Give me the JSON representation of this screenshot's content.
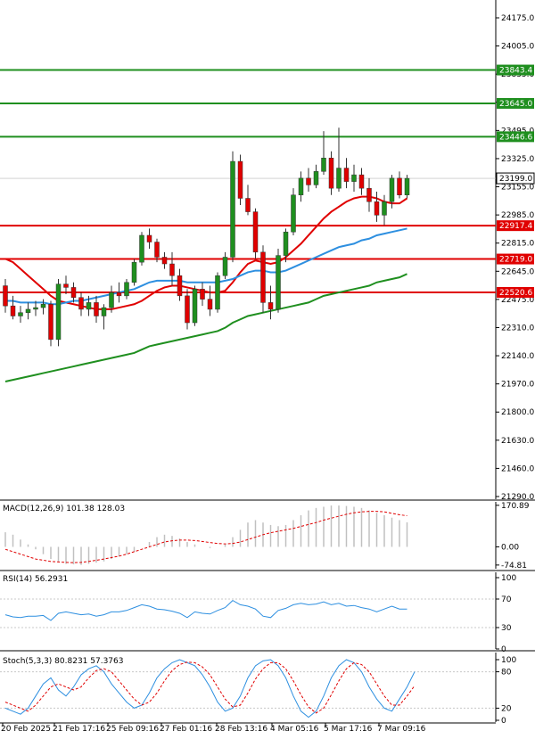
{
  "chart_data": [
    {
      "type": "candlestick",
      "panel": "price",
      "y_ticks": [
        "24175.0",
        "24005.0",
        "23835.0",
        "23665.0",
        "23495.0",
        "23325.0",
        "23155.0",
        "22985.0",
        "22815.0",
        "22645.0",
        "22475.0",
        "22310.0",
        "22140.0",
        "21970.0",
        "21800.0",
        "21630.0",
        "21460.0",
        "21290.0"
      ],
      "ylim": [
        21290,
        24260
      ],
      "levels": [
        {
          "label": "23843.4",
          "value": 23843.4,
          "color": "#1f8f1f"
        },
        {
          "label": "23645.0",
          "value": 23645.0,
          "color": "#1f8f1f"
        },
        {
          "label": "23446.6",
          "value": 23446.6,
          "color": "#1f8f1f"
        },
        {
          "label": "22917.4",
          "value": 22917.4,
          "color": "#e00000"
        },
        {
          "label": "22719.0",
          "value": 22719.0,
          "color": "#e00000"
        },
        {
          "label": "22520.6",
          "value": 22520.6,
          "color": "#e00000"
        }
      ],
      "current_price": {
        "label": "23199.0",
        "value": 23199.0
      },
      "x_ticks": [
        "20 Feb 2025",
        "21 Feb 17:16",
        "25 Feb 09:16",
        "27 Feb 01:16",
        "28 Feb 13:16",
        "4 Mar 05:16",
        "5 Mar 17:16",
        "7 Mar 09:16"
      ],
      "candles": [
        [
          22560,
          22600,
          22400,
          22440
        ],
        [
          22440,
          22500,
          22360,
          22380
        ],
        [
          22380,
          22440,
          22340,
          22400
        ],
        [
          22400,
          22460,
          22360,
          22420
        ],
        [
          22420,
          22470,
          22380,
          22430
        ],
        [
          22430,
          22480,
          22390,
          22450
        ],
        [
          22450,
          22470,
          22200,
          22240
        ],
        [
          22240,
          22600,
          22200,
          22570
        ],
        [
          22570,
          22620,
          22510,
          22550
        ],
        [
          22550,
          22580,
          22460,
          22490
        ],
        [
          22490,
          22520,
          22380,
          22420
        ],
        [
          22420,
          22500,
          22380,
          22460
        ],
        [
          22460,
          22500,
          22340,
          22380
        ],
        [
          22380,
          22450,
          22300,
          22430
        ],
        [
          22430,
          22560,
          22400,
          22520
        ],
        [
          22520,
          22580,
          22460,
          22500
        ],
        [
          22500,
          22600,
          22480,
          22580
        ],
        [
          22580,
          22720,
          22560,
          22700
        ],
        [
          22700,
          22880,
          22680,
          22860
        ],
        [
          22860,
          22900,
          22780,
          22820
        ],
        [
          22820,
          22840,
          22700,
          22730
        ],
        [
          22730,
          22760,
          22660,
          22690
        ],
        [
          22690,
          22760,
          22560,
          22620
        ],
        [
          22620,
          22660,
          22470,
          22500
        ],
        [
          22500,
          22540,
          22300,
          22340
        ],
        [
          22340,
          22560,
          22320,
          22540
        ],
        [
          22540,
          22580,
          22440,
          22480
        ],
        [
          22480,
          22560,
          22380,
          22420
        ],
        [
          22420,
          22640,
          22400,
          22620
        ],
        [
          22620,
          22760,
          22600,
          22730
        ],
        [
          22730,
          23360,
          22700,
          23300
        ],
        [
          23300,
          23340,
          23040,
          23080
        ],
        [
          23080,
          23160,
          22980,
          23000
        ],
        [
          23000,
          23020,
          22720,
          22760
        ],
        [
          22760,
          22800,
          22400,
          22460
        ],
        [
          22460,
          22560,
          22360,
          22420
        ],
        [
          22420,
          22780,
          22400,
          22740
        ],
        [
          22740,
          22900,
          22700,
          22880
        ],
        [
          22880,
          23140,
          22860,
          23100
        ],
        [
          23100,
          23240,
          23060,
          23200
        ],
        [
          23200,
          23260,
          23120,
          23160
        ],
        [
          23160,
          23280,
          23140,
          23240
        ],
        [
          23240,
          23480,
          23220,
          23320
        ],
        [
          23320,
          23360,
          23100,
          23140
        ],
        [
          23140,
          23500,
          23120,
          23260
        ],
        [
          23260,
          23320,
          23140,
          23180
        ],
        [
          23180,
          23280,
          23120,
          23220
        ],
        [
          23220,
          23260,
          23100,
          23140
        ],
        [
          23140,
          23200,
          23000,
          23060
        ],
        [
          23060,
          23120,
          22940,
          22980
        ],
        [
          22980,
          23100,
          22920,
          23060
        ],
        [
          23060,
          23220,
          23020,
          23200
        ],
        [
          23200,
          23240,
          23080,
          23100
        ],
        [
          23100,
          23220,
          23080,
          23199
        ]
      ],
      "ma_series": [
        {
          "color": "#e00000",
          "values": [
            22720,
            22700,
            22660,
            22620,
            22580,
            22540,
            22500,
            22470,
            22460,
            22450,
            22440,
            22430,
            22420,
            22420,
            22420,
            22430,
            22440,
            22450,
            22470,
            22500,
            22530,
            22550,
            22560,
            22560,
            22550,
            22540,
            22530,
            22520,
            22520,
            22530,
            22580,
            22640,
            22690,
            22710,
            22700,
            22690,
            22700,
            22730,
            22770,
            22810,
            22860,
            22910,
            22960,
            23000,
            23030,
            23060,
            23080,
            23090,
            23090,
            23080,
            23060,
            23050,
            23050,
            23080
          ]
        },
        {
          "color": "#2d8fe0",
          "values": [
            22470,
            22470,
            22460,
            22460,
            22460,
            22460,
            22450,
            22450,
            22460,
            22470,
            22470,
            22480,
            22490,
            22500,
            22510,
            22520,
            22530,
            22540,
            22560,
            22580,
            22590,
            22590,
            22590,
            22590,
            22580,
            22580,
            22580,
            22580,
            22580,
            22590,
            22600,
            22620,
            22640,
            22650,
            22650,
            22640,
            22640,
            22650,
            22670,
            22690,
            22710,
            22730,
            22750,
            22770,
            22790,
            22800,
            22810,
            22830,
            22840,
            22860,
            22870,
            22880,
            22890,
            22900
          ]
        },
        {
          "color": "#1f8f1f",
          "values": [
            21990,
            22000,
            22010,
            22020,
            22030,
            22040,
            22050,
            22060,
            22070,
            22080,
            22090,
            22100,
            22110,
            22120,
            22130,
            22140,
            22150,
            22160,
            22180,
            22200,
            22210,
            22220,
            22230,
            22240,
            22250,
            22260,
            22270,
            22280,
            22290,
            22310,
            22340,
            22360,
            22380,
            22390,
            22400,
            22410,
            22420,
            22430,
            22440,
            22450,
            22460,
            22480,
            22500,
            22510,
            22520,
            22530,
            22540,
            22550,
            22560,
            22580,
            22590,
            22600,
            22610,
            22630
          ]
        }
      ]
    },
    {
      "type": "histogram",
      "panel": "macd",
      "title": "MACD(12,26,9) 101.38 128.03",
      "y_ticks": [
        "170.89",
        "0.00",
        "-74.81"
      ],
      "ylim": [
        -90,
        185
      ],
      "histogram": [
        60,
        50,
        30,
        10,
        -10,
        -30,
        -50,
        -60,
        -70,
        -72,
        -74,
        -70,
        -65,
        -60,
        -50,
        -40,
        -30,
        -20,
        0,
        20,
        40,
        50,
        45,
        35,
        20,
        10,
        0,
        -5,
        0,
        10,
        40,
        70,
        100,
        110,
        100,
        90,
        85,
        90,
        110,
        130,
        150,
        160,
        165,
        170,
        170,
        168,
        165,
        160,
        150,
        140,
        130,
        120,
        110,
        101
      ],
      "signal": [
        -10,
        -20,
        -30,
        -40,
        -50,
        -55,
        -60,
        -62,
        -64,
        -65,
        -64,
        -60,
        -55,
        -50,
        -44,
        -38,
        -30,
        -20,
        -10,
        0,
        10,
        20,
        25,
        28,
        28,
        26,
        22,
        18,
        14,
        12,
        14,
        20,
        30,
        40,
        50,
        58,
        64,
        70,
        76,
        84,
        92,
        100,
        110,
        118,
        126,
        134,
        140,
        144,
        146,
        146,
        144,
        138,
        132,
        128
      ]
    },
    {
      "type": "line",
      "panel": "rsi",
      "title": "RSI(14) 56.2931",
      "y_ticks": [
        "100",
        "70",
        "30",
        "0"
      ],
      "ylim": [
        0,
        100
      ],
      "series": [
        {
          "color": "#2d8fe0",
          "values": [
            48,
            45,
            44,
            46,
            46,
            47,
            40,
            50,
            52,
            50,
            48,
            49,
            46,
            48,
            52,
            52,
            54,
            58,
            62,
            60,
            56,
            55,
            53,
            50,
            44,
            52,
            50,
            49,
            54,
            58,
            68,
            62,
            60,
            56,
            46,
            44,
            54,
            57,
            62,
            64,
            62,
            63,
            66,
            62,
            64,
            60,
            61,
            58,
            56,
            52,
            56,
            60,
            56,
            56
          ]
        }
      ]
    },
    {
      "type": "line",
      "panel": "stoch",
      "title": "Stoch(5,3,3) 80.8231 57.3763",
      "y_ticks": [
        "100",
        "80",
        "20",
        "0"
      ],
      "ylim": [
        0,
        100
      ],
      "series": [
        {
          "color": "#2d8fe0",
          "values": [
            20,
            15,
            10,
            20,
            40,
            60,
            70,
            50,
            40,
            55,
            75,
            85,
            90,
            80,
            60,
            45,
            30,
            20,
            25,
            45,
            70,
            85,
            95,
            100,
            95,
            90,
            75,
            55,
            30,
            15,
            20,
            40,
            70,
            90,
            98,
            100,
            90,
            70,
            40,
            15,
            5,
            15,
            40,
            70,
            90,
            100,
            95,
            80,
            55,
            35,
            20,
            15,
            35,
            55,
            80
          ]
        },
        {
          "color": "#e00000",
          "values": [
            30,
            25,
            20,
            15,
            25,
            40,
            55,
            60,
            55,
            50,
            55,
            70,
            82,
            85,
            80,
            65,
            50,
            35,
            25,
            30,
            45,
            65,
            82,
            92,
            96,
            95,
            88,
            75,
            55,
            35,
            22,
            25,
            45,
            68,
            85,
            95,
            95,
            85,
            65,
            42,
            22,
            12,
            20,
            42,
            65,
            85,
            95,
            92,
            80,
            60,
            40,
            25,
            25,
            40,
            57
          ]
        }
      ]
    }
  ]
}
